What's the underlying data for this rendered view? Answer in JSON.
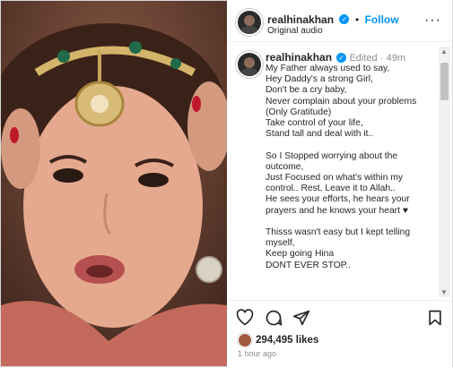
{
  "header": {
    "username": "realhinakhan",
    "follow_label": "Follow",
    "audio_label": "Original audio",
    "more_label": "···"
  },
  "caption": {
    "username": "realhinakhan",
    "edited": "Edited",
    "time": "49m",
    "text": "My Father always used to say,\nHey Daddy's a strong Girl,\nDon't be a cry baby,\nNever complain about your problems\n(Only Gratitude)\nTake control of your life,\nStand tall and deal with it..\n\nSo I Stopped worrying about the\noutcome,\nJust Focused on what's within my\ncontrol.. Rest, Leave it to Allah..\nHe sees your efforts, he hears your\nprayers and he knows your heart ♥\n\nThisss wasn't easy but I kept telling\nmyself,\nKeep going Hina\nDONT EVER STOP.."
  },
  "actions": {
    "likes": "294,495 likes",
    "posted": "1 hour ago"
  },
  "colors": {
    "accent": "#0095f6",
    "text": "#262626",
    "muted": "#8e8e8e"
  },
  "icons": [
    "verified-badge-icon",
    "more-icon",
    "heart-icon",
    "comment-icon",
    "share-icon",
    "save-icon"
  ]
}
